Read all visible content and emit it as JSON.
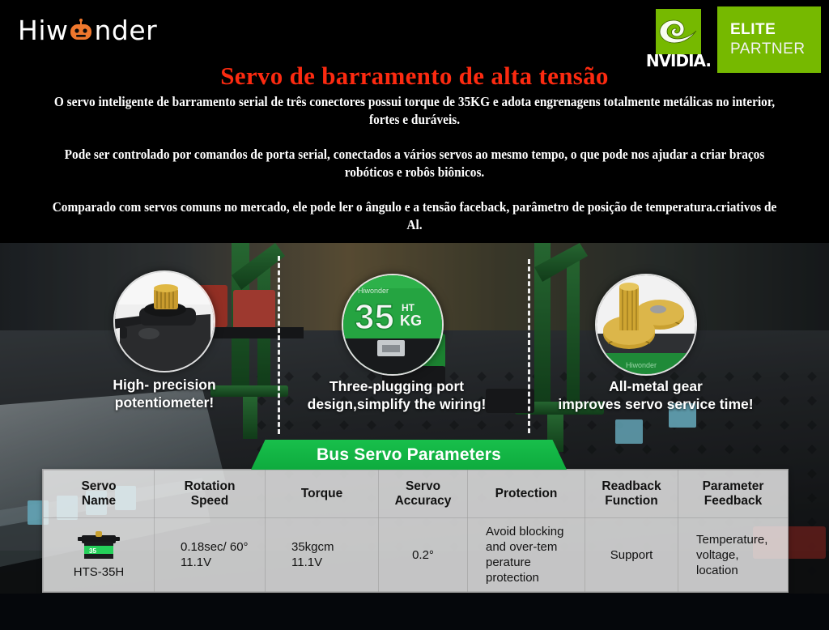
{
  "brand": {
    "logo_text_a": "Hiw",
    "logo_text_b": "nder",
    "logo_icon": "robot-head-icon"
  },
  "partner": {
    "nvidia_word": "NVIDIA.",
    "nvidia_icon": "nvidia-eye-icon",
    "elite_line1": "ELITE",
    "elite_line2": "PARTNER",
    "badge_color": "#76b900"
  },
  "header": {
    "title": "Servo de barramento de alta tensão",
    "title_color": "#fc2a10",
    "paragraph1": "O servo inteligente de barramento serial de três conectores possui torque de 35KG e adota engrenagens totalmente metálicas no interior, fortes e duráveis.",
    "paragraph2": "Pode ser controlado por comandos de porta serial, conectados a vários servos ao mesmo tempo, o que pode nos ajudar a criar braços robóticos e robôs biônicos.",
    "paragraph3": "Comparado com servos comuns no mercado, ele pode ler o ângulo e a tensão faceback, parâmetro de posição de temperatura.criativos de Al."
  },
  "features": [
    {
      "caption": "High- precision\npotentiometer!",
      "caption_line1": "High- precision",
      "caption_line2": "potentiometer!",
      "circle_icon": "potentiometer-closeup-icon"
    },
    {
      "caption_line1": "Three-plugging port",
      "caption_line2": "design,simplify the wiring!",
      "circle_icon": "servo-port-closeup-icon",
      "circle_label": "35KG"
    },
    {
      "caption_line1": "All-metal gear",
      "caption_line2": "improves servo service time!",
      "circle_icon": "metal-gear-closeup-icon"
    }
  ],
  "banner": {
    "label": "Bus Servo Parameters",
    "color": "#12b545"
  },
  "table": {
    "headers": [
      "Servo\nName",
      "Rotation\nSpeed",
      "Torque",
      "Servo\nAccuracy",
      "Protection",
      "Readback\nFunction",
      "Parameter\nFeedback"
    ],
    "headers_split": [
      {
        "l1": "Servo",
        "l2": "Name"
      },
      {
        "l1": "Rotation",
        "l2": "Speed"
      },
      {
        "l1": "Torque",
        "l2": ""
      },
      {
        "l1": "Servo",
        "l2": "Accuracy"
      },
      {
        "l1": "Protection",
        "l2": ""
      },
      {
        "l1": "Readback",
        "l2": "Function"
      },
      {
        "l1": "Parameter",
        "l2": "Feedback"
      }
    ],
    "rows": [
      {
        "servo_name": "HTS-35H",
        "servo_image": "hts-35h-servo-photo",
        "rotation_speed_l1": "0.18sec/ 60°",
        "rotation_speed_l2": "11.1V",
        "torque_l1": "35kgcm",
        "torque_l2": "11.1V",
        "servo_accuracy": "0.2°",
        "protection_l1": "Avoid blocking",
        "protection_l2": "and over-tem",
        "protection_l3": "perature",
        "protection_l4": "protection",
        "readback_function": "Support",
        "parameter_feedback_l1": "Temperature,",
        "parameter_feedback_l2": "voltage,",
        "parameter_feedback_l3": "location"
      }
    ]
  }
}
